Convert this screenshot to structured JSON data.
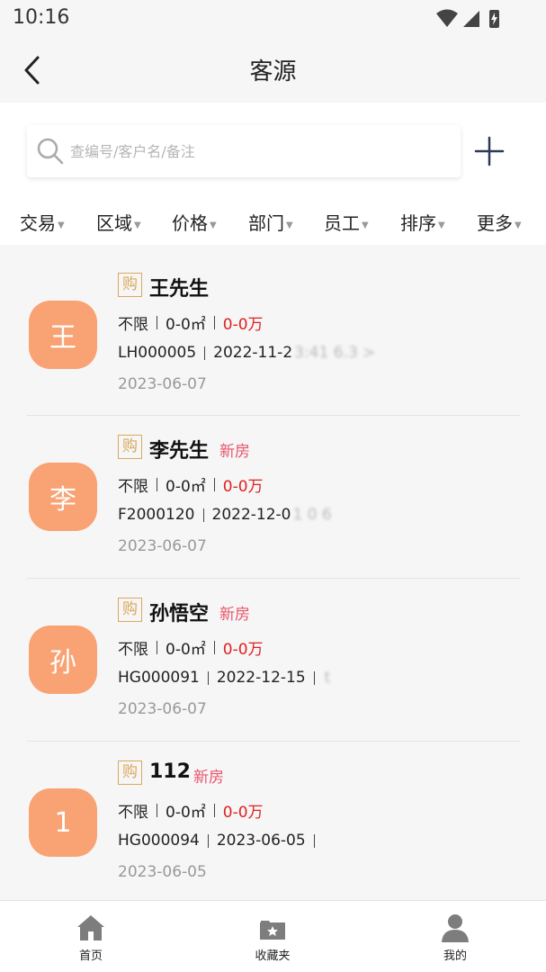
{
  "status_bar": {
    "time": "10:16"
  },
  "header": {
    "title": "客源"
  },
  "search": {
    "placeholder": "查编号/客户名/备注"
  },
  "filters": [
    {
      "label": "交易"
    },
    {
      "label": "区域"
    },
    {
      "label": "价格"
    },
    {
      "label": "部门"
    },
    {
      "label": "员工"
    },
    {
      "label": "排序"
    },
    {
      "label": "更多"
    }
  ],
  "customers": [
    {
      "avatar": "王",
      "type": "购",
      "name": "王先生",
      "tag": "",
      "purpose": "不限",
      "area": "0-0㎡",
      "price": "0-0万",
      "code": "LH000005",
      "created": "2022-11-2",
      "blurred": "3:41 6.3 >",
      "date": "2023-06-07"
    },
    {
      "avatar": "李",
      "type": "购",
      "name": "李先生",
      "tag": "新房",
      "purpose": "不限",
      "area": "0-0㎡",
      "price": "0-0万",
      "code": "F2000120",
      "created": "2022-12-0",
      "blurred": "1 0 6",
      "date": "2023-06-07"
    },
    {
      "avatar": "孙",
      "type": "购",
      "name": "孙悟空",
      "tag": "新房",
      "purpose": "不限",
      "area": "0-0㎡",
      "price": "0-0万",
      "code": "HG000091",
      "created": "2022-12-15",
      "blurred": "t",
      "date": "2023-06-07"
    },
    {
      "avatar": "1",
      "type": "购",
      "name": "112",
      "tag": "新房",
      "purpose": "不限",
      "area": "0-0㎡",
      "price": "0-0万",
      "code": "HG000094",
      "created": "2023-06-05",
      "blurred": "",
      "date": "2023-06-05"
    }
  ],
  "bottom_nav": [
    {
      "label": "首页",
      "icon": "home-icon"
    },
    {
      "label": "收藏夹",
      "icon": "favorites-folder-icon"
    },
    {
      "label": "我的",
      "icon": "profile-icon"
    }
  ],
  "colors": {
    "accent_avatar": "#f9a273",
    "price_red": "#e02020",
    "tag_pink": "#e8556b",
    "badge_gold": "#d9a85c"
  }
}
